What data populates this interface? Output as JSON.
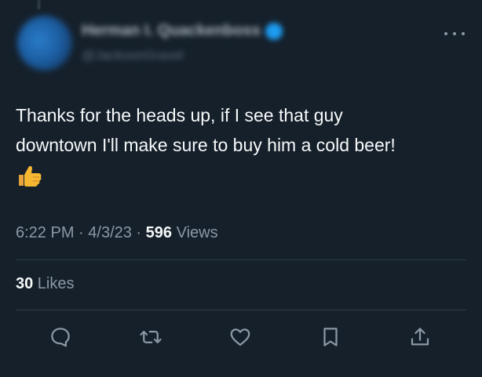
{
  "author": {
    "display_name": "Herman I. Quackenboss",
    "handle": "@JacksonGravel"
  },
  "tweet": {
    "text_line_1": "Thanks for the heads up, if I see that guy",
    "text_line_2": "downtown I'll make sure to buy him a cold beer!",
    "emoji": "👍"
  },
  "meta": {
    "time": "6:22 PM",
    "separator_1": " · ",
    "date": "4/3/23",
    "separator_2": " · ",
    "views_count": "596",
    "views_label": " Views"
  },
  "stats": {
    "likes_count": "30",
    "likes_label": " Likes"
  },
  "actions": [
    "reply-icon",
    "retweet-icon",
    "like-icon",
    "bookmark-icon",
    "share-icon"
  ],
  "colors": {
    "background": "#15202b",
    "text": "#f7f9f9",
    "secondary": "#8b98a5",
    "verified": "#1d9bf0",
    "emoji": "#f5b731"
  }
}
